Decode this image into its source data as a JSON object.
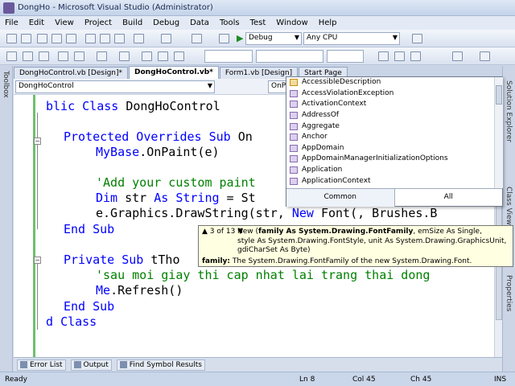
{
  "window": {
    "title": "DongHo - Microsoft Visual Studio (Administrator)"
  },
  "menu": [
    "File",
    "Edit",
    "View",
    "Project",
    "Build",
    "Debug",
    "Data",
    "Tools",
    "Test",
    "Window",
    "Help"
  ],
  "toolbar": {
    "config": "Debug",
    "platform": "Any CPU"
  },
  "side": {
    "left": "Toolbox",
    "right_top": "Solution Explorer",
    "right_mid": "Class View",
    "right_bot": "Properties"
  },
  "tabs": [
    {
      "label": "DongHoControl.vb [Design]*"
    },
    {
      "label": "DongHoControl.vb*"
    },
    {
      "label": "Form1.vb [Design]"
    },
    {
      "label": "Start Page"
    }
  ],
  "nav": {
    "left": "DongHoControl",
    "right": "OnPaint"
  },
  "code": {
    "l1a": "blic ",
    "l1b": "Class",
    "l1c": " DongHoControl",
    "l2a": "Protected Overrides Sub",
    "l2b": " On",
    "l3a": "MyBase",
    "l3b": ".OnPaint(e)",
    "l4": "'Add your custom paint",
    "l5a": "Dim",
    "l5b": " str ",
    "l5c": "As String",
    "l5d": " = St",
    "l6a": "e.Graphics.DrawString(str, ",
    "l6b": "New",
    "l6c": " Font(, Brushes.B",
    "l7": "End Sub",
    "l8a": "Private Sub",
    "l8b": " tTho",
    "l9": "'sau moi giay thi cap nhat lai trang thai dong",
    "l10a": "Me",
    "l10b": ".Refresh()",
    "l11": "End Sub",
    "l12a": "d ",
    "l12b": "Class"
  },
  "intellisense": {
    "items": [
      "AccessibleDescription",
      "AccessViolationException",
      "ActivationContext",
      "AddressOf",
      "Aggregate",
      "Anchor",
      "AppDomain",
      "AppDomainManagerInitializationOptions",
      "Application",
      "ApplicationContext"
    ],
    "tab_common": "Common",
    "tab_all": "All"
  },
  "paraminfo": {
    "counter": "3 of 13",
    "sig_a": "New (",
    "sig_b": "family As System.Drawing.FontFamily",
    "sig_c": ", emSize As Single,",
    "sig_d": "style As System.Drawing.FontStyle, unit As System.Drawing.GraphicsUnit,",
    "sig_e": "gdiCharSet As Byte)",
    "desc_a": "family:",
    "desc_b": " The System.Drawing.FontFamily of the new System.Drawing.Font."
  },
  "bottom_tabs": [
    "Error List",
    "Output",
    "Find Symbol Results"
  ],
  "status": {
    "ready": "Ready",
    "ln": "Ln 8",
    "col": "Col 45",
    "ch": "Ch 45",
    "ins": "INS"
  }
}
